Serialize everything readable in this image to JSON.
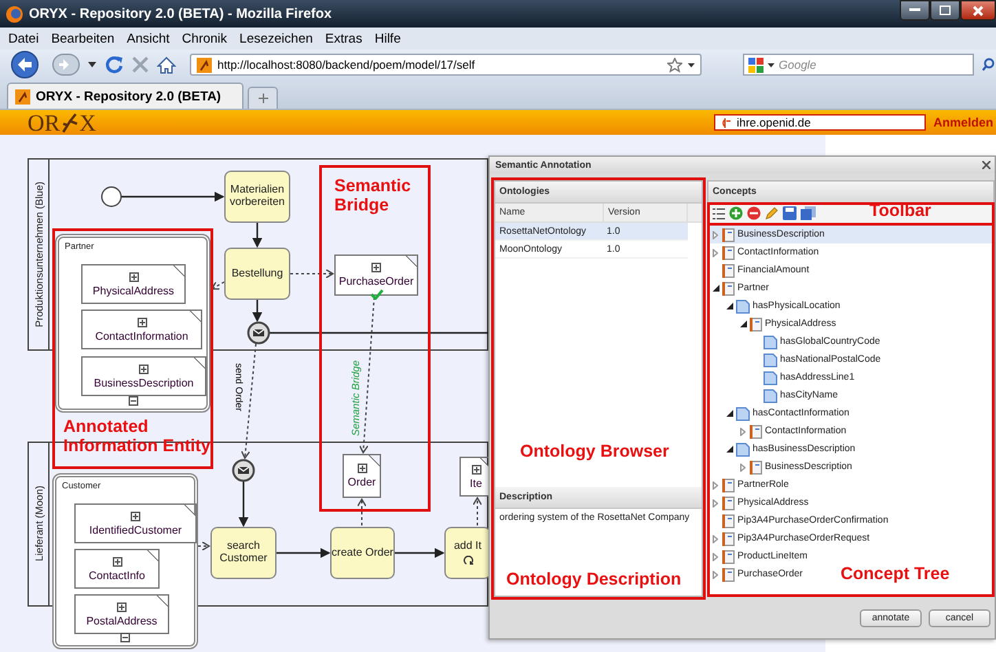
{
  "window": {
    "title": "ORYX - Repository 2.0 (BETA) - Mozilla Firefox"
  },
  "menu": [
    "Datei",
    "Bearbeiten",
    "Ansicht",
    "Chronik",
    "Lesezeichen",
    "Extras",
    "Hilfe"
  ],
  "navigation": {
    "url": "http://localhost:8080/backend/poem/model/17/self",
    "search_placeholder": "Google"
  },
  "tabs": [
    {
      "label": "ORYX - Repository 2.0 (BETA)",
      "selected": true
    }
  ],
  "header": {
    "logo_left": "OR",
    "logo_right": "X",
    "openid": "ihre.openid.de",
    "login": "Anmelden"
  },
  "diagram": {
    "pools": [
      {
        "label": "Produktionsunternehmen (Blue)"
      },
      {
        "label": "Lieferant (Moon)"
      }
    ],
    "tasks": [
      {
        "label": "Materialien vorbereiten",
        "loop": false
      },
      {
        "label": "Bestellung",
        "loop": false
      },
      {
        "label": "search Customer",
        "loop": false
      },
      {
        "label": "create Order",
        "loop": false
      },
      {
        "label": "add It",
        "loop": true
      }
    ],
    "containers": [
      {
        "title": "Partner",
        "items": [
          "PhysicalAddress",
          "ContactInformation",
          "BusinessDescription"
        ]
      },
      {
        "title": "Customer",
        "items": [
          "IdentifiedCustomer",
          "ContactInfo",
          "PostalAddress"
        ]
      }
    ],
    "documents": [
      {
        "label": "PurchaseOrder",
        "validated": true
      },
      {
        "label": "Order",
        "validated": false
      },
      {
        "label": "Ite",
        "validated": false
      }
    ],
    "edge_labels": [
      {
        "label": "send Order",
        "kind": "message"
      },
      {
        "label": "Semantic Bridge",
        "kind": "bridge"
      }
    ],
    "annotations": [
      {
        "label": "Semantic Bridge"
      },
      {
        "label": "Annotated Information Entity"
      }
    ]
  },
  "dialog": {
    "title": "Semantic Annotation",
    "ontologies": {
      "title": "Ontologies",
      "columns": [
        "Name",
        "Version"
      ],
      "rows": [
        {
          "name": "RosettaNetOntology",
          "version": "1.0",
          "selected": true
        },
        {
          "name": "MoonOntology",
          "version": "1.0",
          "selected": false
        }
      ]
    },
    "description": {
      "title": "Description",
      "text": "ordering system of the RosettaNet Company"
    },
    "concepts": {
      "title": "Concepts",
      "tree": [
        {
          "label": "BusinessDescription",
          "kind": "class",
          "expanded": false,
          "selected": true
        },
        {
          "label": "ContactInformation",
          "kind": "class",
          "expanded": false,
          "selected": false
        },
        {
          "label": "FinancialAmount",
          "kind": "class",
          "selected": false
        },
        {
          "label": "Partner",
          "kind": "class",
          "expanded": true,
          "selected": false,
          "children": [
            {
              "label": "hasPhysicalLocation",
              "kind": "property",
              "expanded": true,
              "selected": false,
              "children": [
                {
                  "label": "PhysicalAddress",
                  "kind": "class",
                  "expanded": true,
                  "selected": false,
                  "children": [
                    {
                      "label": "hasGlobalCountryCode",
                      "kind": "property",
                      "selected": false
                    },
                    {
                      "label": "hasNationalPostalCode",
                      "kind": "property",
                      "selected": false
                    },
                    {
                      "label": "hasAddressLine1",
                      "kind": "property",
                      "selected": false
                    },
                    {
                      "label": "hasCityName",
                      "kind": "property",
                      "selected": false
                    }
                  ]
                }
              ]
            },
            {
              "label": "hasContactInformation",
              "kind": "property",
              "expanded": true,
              "selected": false,
              "children": [
                {
                  "label": "ContactInformation",
                  "kind": "class",
                  "expanded": false,
                  "selected": false
                }
              ]
            },
            {
              "label": "hasBusinessDescription",
              "kind": "property",
              "expanded": true,
              "selected": false,
              "children": [
                {
                  "label": "BusinessDescription",
                  "kind": "class",
                  "expanded": false,
                  "selected": false
                }
              ]
            }
          ]
        },
        {
          "label": "PartnerRole",
          "kind": "class",
          "expanded": false,
          "selected": false
        },
        {
          "label": "PhysicalAddress",
          "kind": "class",
          "expanded": false,
          "selected": false
        },
        {
          "label": "Pip3A4PurchaseOrderConfirmation",
          "kind": "class",
          "selected": false
        },
        {
          "label": "Pip3A4PurchaseOrderRequest",
          "kind": "class",
          "expanded": false,
          "selected": false
        },
        {
          "label": "ProductLineItem",
          "kind": "class",
          "expanded": false,
          "selected": false
        },
        {
          "label": "PurchaseOrder",
          "kind": "class",
          "expanded": false,
          "selected": false
        }
      ]
    },
    "buttons": [
      "annotate",
      "cancel"
    ],
    "annotations": [
      {
        "label": "Ontology Browser"
      },
      {
        "label": "Ontology Description"
      },
      {
        "label": "Toolbar"
      },
      {
        "label": "Concept Tree"
      }
    ]
  }
}
